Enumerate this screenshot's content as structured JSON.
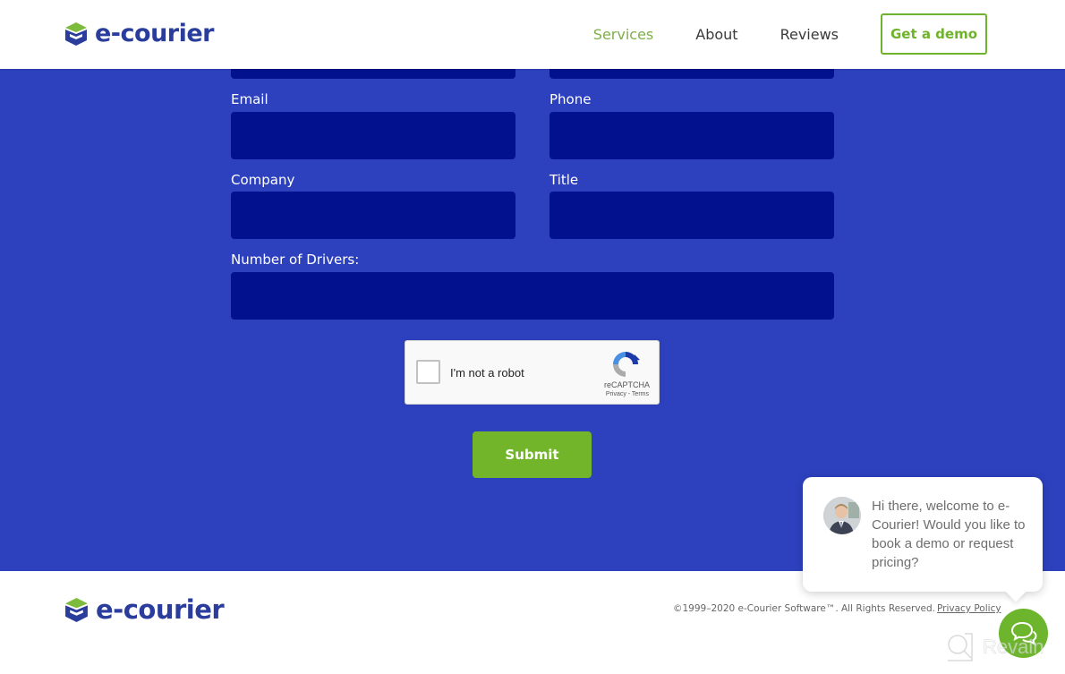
{
  "header": {
    "logo_text": "e-courier",
    "nav": [
      {
        "label": "Services",
        "active": true
      },
      {
        "label": "About",
        "active": false
      },
      {
        "label": "Reviews",
        "active": false
      }
    ],
    "cta_label": "Get a demo"
  },
  "form": {
    "fields": [
      {
        "label": "Email",
        "value": "",
        "placeholder": ""
      },
      {
        "label": "Phone",
        "value": "",
        "placeholder": ""
      },
      {
        "label": "Company",
        "value": "",
        "placeholder": ""
      },
      {
        "label": "Title",
        "value": "",
        "placeholder": ""
      },
      {
        "label": "Number of Drivers:",
        "value": "",
        "placeholder": ""
      }
    ],
    "recaptcha": {
      "label": "I'm not a robot",
      "brand": "reCAPTCHA",
      "links": "Privacy - Terms",
      "checked": false
    },
    "submit_label": "Submit"
  },
  "footer": {
    "logo_text": "e-courier",
    "copyright": "©1999–2020 e-Courier Software™. All Rights Reserved.",
    "privacy_label": "Privacy Policy"
  },
  "chat": {
    "message": "Hi there, welcome to e-Courier! Would you like to book a demo or request pricing?"
  },
  "watermark": {
    "text": "Revain"
  },
  "colors": {
    "brand_blue": "#2a3d9c",
    "form_bg": "#2d41bf",
    "input_bg": "#02128f",
    "accent_green": "#72b52a"
  }
}
